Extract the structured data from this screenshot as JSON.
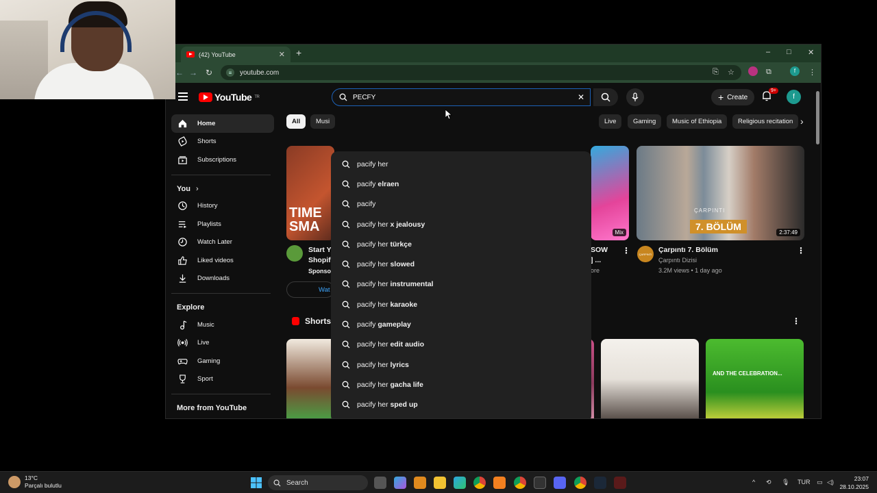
{
  "browser": {
    "tab_title": "(42) YouTube",
    "new_tab": "+",
    "url": "youtube.com",
    "controls": {
      "minimize": "–",
      "maximize": "□",
      "close": "✕"
    },
    "profile_letter": "f"
  },
  "youtube": {
    "logo_text": "YouTube",
    "logo_region": "TR",
    "search_value": "PECFY",
    "create_label": "Create",
    "notification_count": "9+",
    "avatar_letter": "f",
    "sidebar": {
      "main": [
        {
          "label": "Home",
          "icon": "home-icon",
          "active": true
        },
        {
          "label": "Shorts",
          "icon": "shorts-icon"
        },
        {
          "label": "Subscriptions",
          "icon": "subscriptions-icon"
        }
      ],
      "you_heading": "You",
      "you_chevron": "›",
      "you": [
        {
          "label": "History",
          "icon": "history-icon"
        },
        {
          "label": "Playlists",
          "icon": "playlists-icon"
        },
        {
          "label": "Watch Later",
          "icon": "watch-later-icon"
        },
        {
          "label": "Liked videos",
          "icon": "liked-icon"
        },
        {
          "label": "Downloads",
          "icon": "downloads-icon"
        }
      ],
      "explore_heading": "Explore",
      "explore": [
        {
          "label": "Music",
          "icon": "music-icon"
        },
        {
          "label": "Live",
          "icon": "live-icon"
        },
        {
          "label": "Gaming",
          "icon": "gaming-icon"
        },
        {
          "label": "Sport",
          "icon": "sport-icon"
        }
      ],
      "more_heading": "More from YouTube"
    },
    "chips": [
      "All",
      "Musi",
      "Live",
      "Gaming",
      "Music of Ethiopia",
      "Religious recitation"
    ],
    "chip_next": "›",
    "suggestions": [
      {
        "prefix": "pacify her",
        "rest": ""
      },
      {
        "prefix": "pacify ",
        "rest": "elraen"
      },
      {
        "prefix": "pacify",
        "rest": ""
      },
      {
        "prefix": "pacify her",
        "rest": " x jealousy"
      },
      {
        "prefix": "pacify her",
        "rest": " türkçe"
      },
      {
        "prefix": "pacify her",
        "rest": " slowed"
      },
      {
        "prefix": "pacify her",
        "rest": " instrumental"
      },
      {
        "prefix": "pacify her",
        "rest": " karaoke"
      },
      {
        "prefix": "pacify",
        "rest": " gameplay"
      },
      {
        "prefix": "pacify her",
        "rest": " edit audio"
      },
      {
        "prefix": "pacify her",
        "rest": " lyrics"
      },
      {
        "prefix": "pacify her",
        "rest": " gacha life"
      },
      {
        "prefix": "pacify her",
        "rest": " sped up"
      }
    ],
    "ad": {
      "title_fragment_1": "Start Y",
      "title_fragment_2": "Shopify",
      "sponsored": "Sponsor",
      "button_fragment": "Wat",
      "thumb_text_1": "TIME",
      "thumb_text_2": "SMA"
    },
    "mix_card": {
      "badge": "Mix",
      "title_fragment_1": "SOW",
      "title_fragment_2": "] ...",
      "meta_fragment": "ore"
    },
    "video": {
      "title": "Çarpıntı 7. Bölüm",
      "channel": "Çarpıntı Dizisi",
      "meta": "3.2M views • 1 day ago",
      "duration": "2:37:49",
      "thumb_caption": "7. BÖLÜM",
      "thumb_logo": "ÇARPINTI",
      "channel_avatar_text": "ÇARPINTI"
    },
    "shorts_heading": "Shorts",
    "short_caption": "AND THE CELEBRATION..."
  },
  "taskbar": {
    "weather_temp": "13°C",
    "weather_desc": "Parçalı bulutlu",
    "search_label": "Search",
    "language": "TUR",
    "time": "23:07",
    "date": "28.10.2025"
  },
  "colors": {
    "youtube_red": "#ff0000",
    "search_border": "#1c62b9",
    "browser_frame": "#1f3a26",
    "dropdown_bg": "#212121"
  }
}
